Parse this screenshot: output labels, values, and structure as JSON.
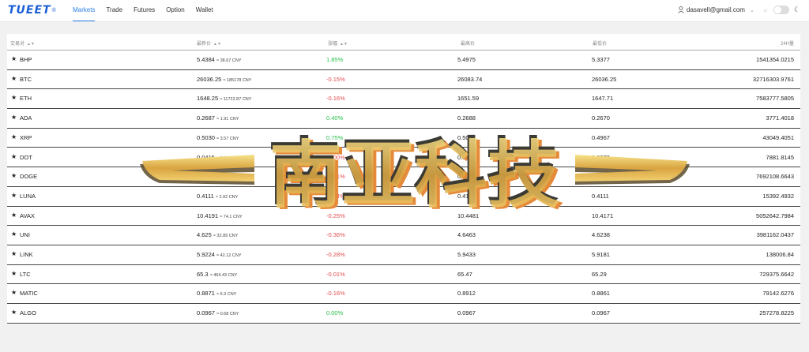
{
  "header": {
    "logo": "TUEET",
    "nav": [
      "Markets",
      "Trade",
      "Futures",
      "Option",
      "Wallet"
    ],
    "user_email": "dasavell@gmail.com"
  },
  "table": {
    "columns": [
      "交易对",
      "最新价",
      "涨幅",
      "最高价",
      "最低价",
      "24H量"
    ],
    "rows": [
      {
        "symbol": "BHP",
        "price": "5.4384",
        "cny": "≈ 38.67 CNY",
        "change": "1.85%",
        "high": "5.4975",
        "low": "5.3377",
        "volume": "1541354.0215",
        "dir": "up"
      },
      {
        "symbol": "BTC",
        "price": "26036.25",
        "cny": "≈ 185178 CNY",
        "change": "-0.15%",
        "high": "26083.74",
        "low": "26036.25",
        "volume": "32716303.9761",
        "dir": "down"
      },
      {
        "symbol": "ETH",
        "price": "1648.25",
        "cny": "≈ 11722.87 CNY",
        "change": "-0.16%",
        "high": "1651.59",
        "low": "1647.71",
        "volume": "7583777.5805",
        "dir": "down"
      },
      {
        "symbol": "ADA",
        "price": "0.2687",
        "cny": "≈ 1.91 CNY",
        "change": "0.40%",
        "high": "0.2688",
        "low": "0.2670",
        "volume": "3771.4018",
        "dir": "up"
      },
      {
        "symbol": "XRP",
        "price": "0.5030",
        "cny": "≈ 3.57 CNY",
        "change": "0.75%",
        "high": "0.5037",
        "low": "0.4967",
        "volume": "43049.4051",
        "dir": "up"
      },
      {
        "symbol": "DOT",
        "price": "0.0415",
        "cny": "≈ 0.29 CNY",
        "change": "-0.00%",
        "high": "0.0416",
        "low": "0.0373",
        "volume": "7881.8145",
        "dir": "down"
      },
      {
        "symbol": "DOGE",
        "price": "0.0611",
        "cny": "≈ 0.44 CNY",
        "change": "-0.21%",
        "high": "0.06114",
        "low": "0.06115",
        "volume": "7692108.6643",
        "dir": "down"
      },
      {
        "symbol": "LUNA",
        "price": "0.4111",
        "cny": "≈ 2.92 CNY",
        "change": "-0.24%",
        "high": "0.4123",
        "low": "0.4111",
        "volume": "15392.4932",
        "dir": "down"
      },
      {
        "symbol": "AVAX",
        "price": "10.4191",
        "cny": "≈ 74.1 CNY",
        "change": "-0.25%",
        "high": "10.4481",
        "low": "10.4171",
        "volume": "5052642.7984",
        "dir": "down"
      },
      {
        "symbol": "UNI",
        "price": "4.625",
        "cny": "≈ 32.89 CNY",
        "change": "-0.36%",
        "high": "4.6463",
        "low": "4.6238",
        "volume": "3981162.0437",
        "dir": "down"
      },
      {
        "symbol": "LINK",
        "price": "5.9224",
        "cny": "≈ 42.12 CNY",
        "change": "-0.28%",
        "high": "5.9433",
        "low": "5.9181",
        "volume": "138006.84",
        "dir": "down"
      },
      {
        "symbol": "LTC",
        "price": "65.3",
        "cny": "≈ 464.43 CNY",
        "change": "-0.01%",
        "high": "65.47",
        "low": "65.29",
        "volume": "729375.6642",
        "dir": "down"
      },
      {
        "symbol": "MATIC",
        "price": "0.8871",
        "cny": "≈ 6.3 CNY",
        "change": "-0.16%",
        "high": "0.8912",
        "low": "0.8861",
        "volume": "79142.6276",
        "dir": "down"
      },
      {
        "symbol": "ALGO",
        "price": "0.0967",
        "cny": "≈ 0.68 CNY",
        "change": "0.00%",
        "high": "0.0967",
        "low": "0.0967",
        "volume": "257278.8225",
        "dir": "up"
      }
    ]
  },
  "watermark": {
    "text": "南亚科技"
  },
  "colors": {
    "accent": "#2a7fe8",
    "up": "#2bc14e",
    "down": "#e24b4b"
  }
}
